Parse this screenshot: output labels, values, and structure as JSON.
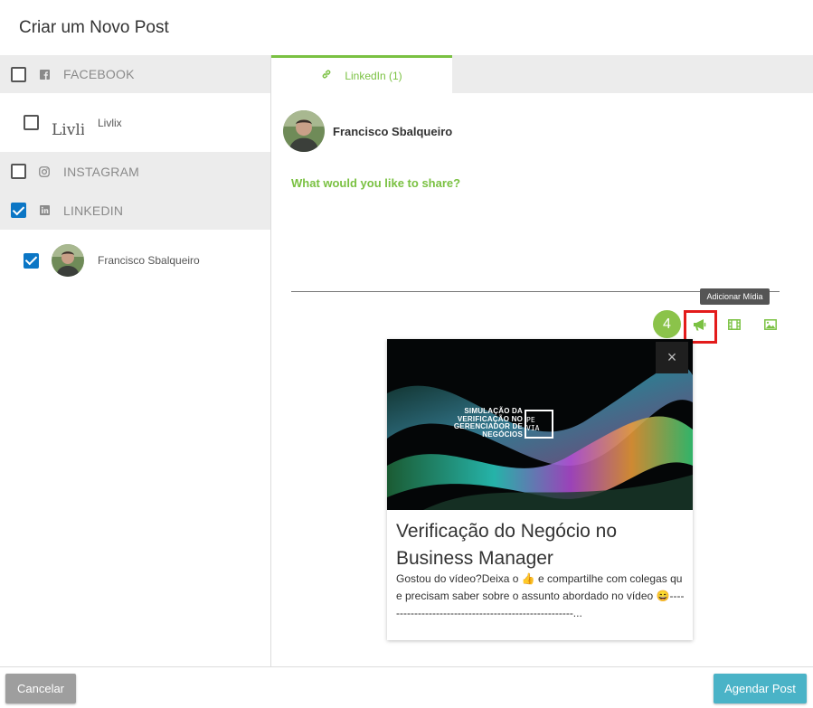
{
  "header": {
    "title": "Criar um Novo Post"
  },
  "networks": {
    "facebook": {
      "label": "FACEBOOK",
      "checked": false,
      "icon": "facebook-icon",
      "accounts": [
        {
          "name": "Livlix",
          "logo_text": "Livlix",
          "checked": false
        }
      ]
    },
    "instagram": {
      "label": "INSTAGRAM",
      "checked": false,
      "icon": "instagram-icon"
    },
    "linkedin": {
      "label": "LINKEDIN",
      "checked": true,
      "icon": "linkedin-icon",
      "accounts": [
        {
          "name": "Francisco Sbalqueiro",
          "checked": true
        }
      ]
    }
  },
  "tabs": [
    {
      "label": "LinkedIn (1)",
      "icon": "link-icon",
      "active": true
    }
  ],
  "composer": {
    "author": "Francisco Sbalqueiro",
    "placeholder": "What would you like to share?"
  },
  "media_toolbar": {
    "tooltip": "Adicionar Mídia",
    "step_number": "4",
    "buttons": [
      "megaphone-icon",
      "film-icon",
      "image-icon"
    ]
  },
  "preview_card": {
    "close_symbol": "×",
    "image_caption": "SIMULAÇÃO DA VERIFICAÇÃO NO GERENCIADOR DE NEGÓCIOS",
    "image_logo": "PE VIA",
    "title": "Verificação do Negócio no Business Manager",
    "description": "Gostou do vídeo?Deixa o 👍 e compartilhe com colegas que precisam saber sobre o assunto abordado no vídeo 😄-----------------------------------------------------..."
  },
  "footer": {
    "cancel_label": "Cancelar",
    "schedule_label": "Agendar Post"
  },
  "colors": {
    "accent_green": "#7ac142",
    "checkbox_blue": "#0b76c5",
    "highlight_red": "#e31b1b",
    "schedule_button": "#4ab3c7",
    "cancel_button": "#9e9e9e"
  }
}
